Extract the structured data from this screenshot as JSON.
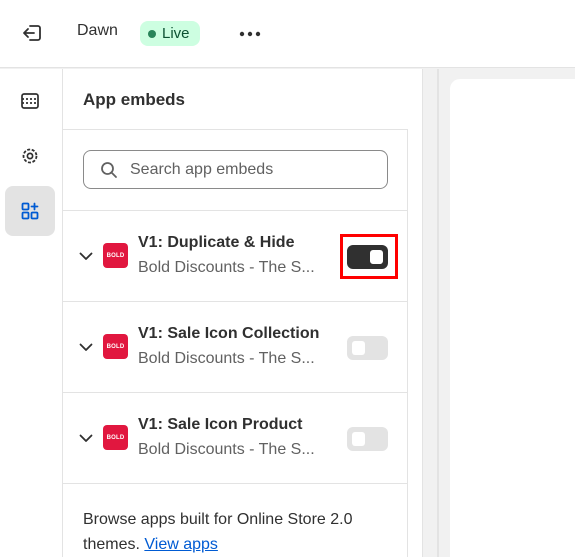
{
  "topbar": {
    "theme_name": "Dawn",
    "status_badge": "Live",
    "exit_icon": "exit-icon",
    "more_icon": "more-horizontal-icon"
  },
  "rail": {
    "items": [
      {
        "icon": "sections-icon",
        "active": false
      },
      {
        "icon": "settings-icon",
        "active": false
      },
      {
        "icon": "app-embeds-icon",
        "active": true
      }
    ]
  },
  "panel": {
    "title": "App embeds",
    "search": {
      "placeholder": "Search app embeds",
      "value": ""
    },
    "embeds": [
      {
        "title": "V1: Duplicate & Hide",
        "subtitle": "Bold Discounts - The S...",
        "logo": "BOLD",
        "enabled": true
      },
      {
        "title": "V1: Sale Icon Collection",
        "subtitle": "Bold Discounts - The S...",
        "logo": "BOLD",
        "enabled": false
      },
      {
        "title": "V1: Sale Icon Product",
        "subtitle": "Bold Discounts - The S...",
        "logo": "BOLD",
        "enabled": false
      }
    ],
    "footer_text": "Browse apps built for Online Store 2.0 themes.",
    "footer_link": "View apps"
  },
  "colors": {
    "accent_live_bg": "#cdfee1",
    "accent_live_dot": "#29845a",
    "bold_logo": "#e1173f",
    "toggle_on": "#303030",
    "toggle_off": "#e3e3e3",
    "link": "#005bd3",
    "highlight": "#ff0000"
  }
}
